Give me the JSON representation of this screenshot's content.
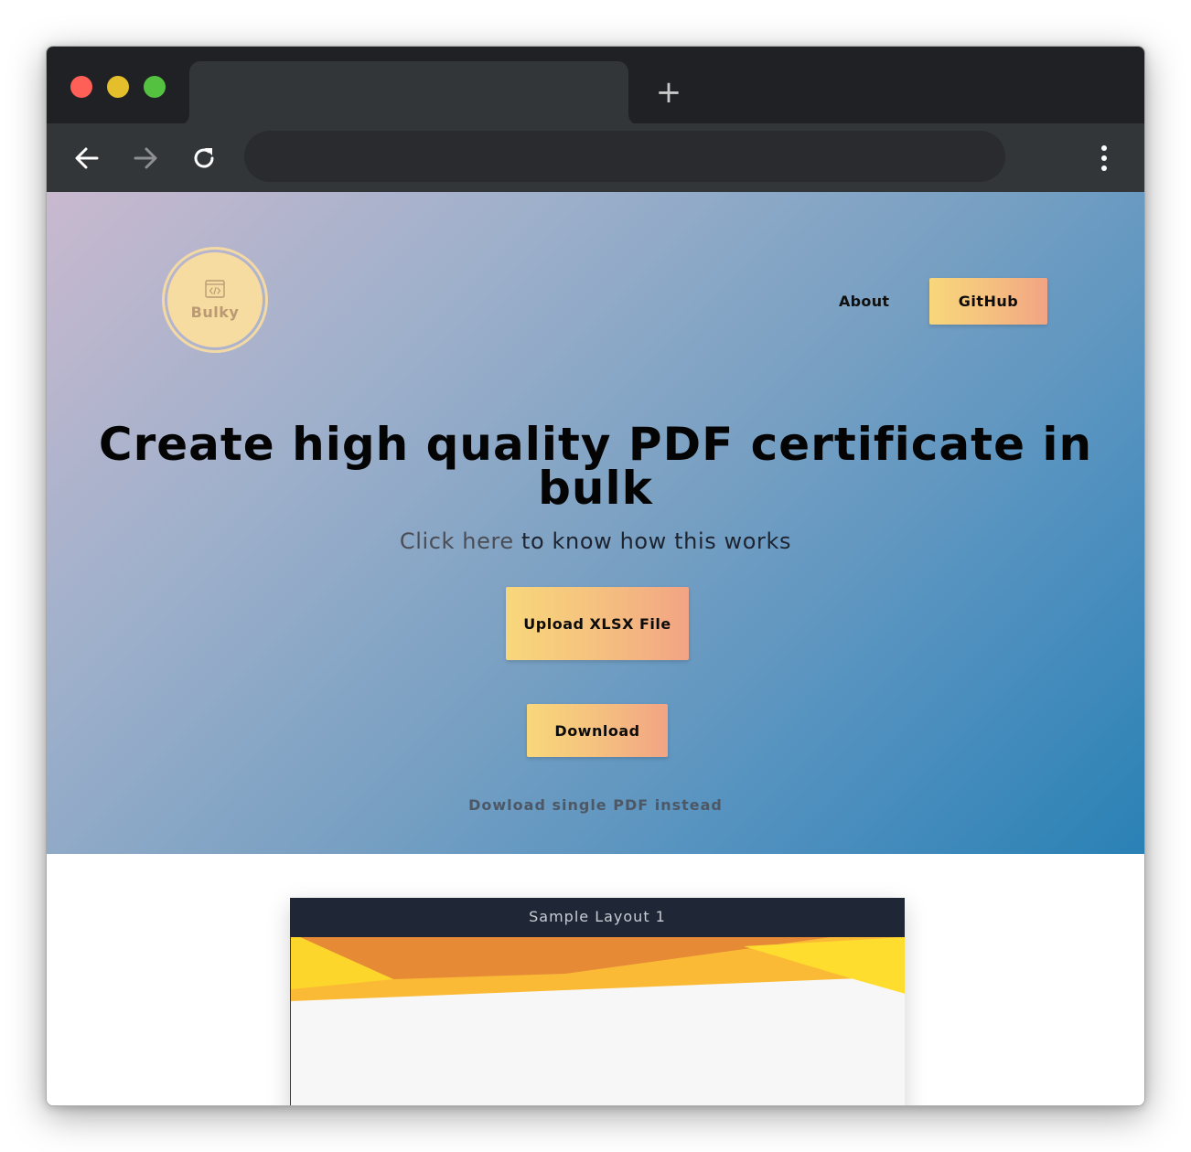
{
  "browser": {
    "tab_title": "",
    "address": "",
    "new_tab_symbol": "+"
  },
  "site": {
    "logo_text": "Bulky",
    "nav": {
      "about_label": "About",
      "github_label": "GitHub"
    },
    "hero": {
      "headline": "Create high quality PDF certificate in bulk",
      "subline_link": "Click here",
      "subline_rest": " to know how this works",
      "upload_label": "Upload XLSX File",
      "download_label": "Download",
      "single_pdf_label": "Dowload single PDF instead"
    },
    "sample": {
      "title": "Sample Layout 1"
    }
  },
  "colors": {
    "accent_gradient_start": "#f8d77b",
    "accent_gradient_end": "#f2a484",
    "hero_gradient_start": "#c9b9cf",
    "hero_gradient_end": "#2a81b5",
    "sample_header": "#1f2736"
  },
  "icons": {
    "back": "arrow-left-icon",
    "forward": "arrow-right-icon",
    "reload": "reload-icon",
    "menu": "vertical-dots-icon",
    "logo": "code-window-icon"
  }
}
